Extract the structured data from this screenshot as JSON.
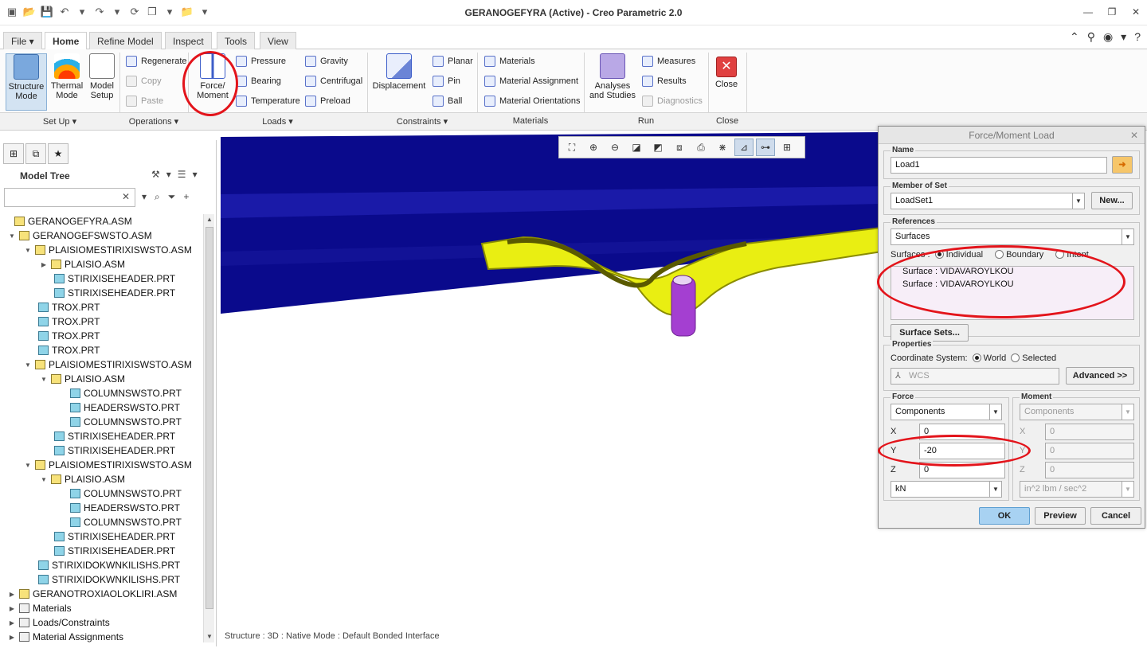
{
  "window": {
    "title": "GERANOGEFYRA (Active) - Creo Parametric 2.0"
  },
  "tabs": [
    {
      "label": "File ▾"
    },
    {
      "label": "Home"
    },
    {
      "label": "Refine Model"
    },
    {
      "label": "Inspect"
    },
    {
      "label": "Tools"
    },
    {
      "label": "View"
    }
  ],
  "ribbon": {
    "setup": {
      "structure": "Structure Mode",
      "thermal": "Thermal Mode",
      "model_setup": "Model Setup",
      "group": "Set Up ▾"
    },
    "operations": {
      "regenerate": "Regenerate",
      "copy": "Copy",
      "paste": "Paste",
      "group": "Operations ▾"
    },
    "loads": {
      "force_moment": "Force/ Moment",
      "pressure": "Pressure",
      "bearing": "Bearing",
      "temperature": "Temperature",
      "gravity": "Gravity",
      "centrifugal": "Centrifugal",
      "preload": "Preload",
      "group": "Loads ▾"
    },
    "constraints": {
      "displacement": "Displacement",
      "planar": "Planar",
      "pin": "Pin",
      "ball": "Ball",
      "group": "Constraints ▾"
    },
    "materials": {
      "materials": "Materials",
      "assignment": "Material Assignment",
      "orientations": "Material Orientations",
      "group": "Materials"
    },
    "run": {
      "analyses": "Analyses and Studies",
      "measures": "Measures",
      "results": "Results",
      "diagnostics": "Diagnostics",
      "group": "Run"
    },
    "close": {
      "label": "Close",
      "group": "Close"
    }
  },
  "model_tree": {
    "title": "Model Tree",
    "items": [
      {
        "label": "GERANOGEFYRA.ASM"
      },
      {
        "label": "GERANOGEFSWSTO.ASM"
      },
      {
        "label": "PLAISIOMESTIRIXISWSTO.ASM"
      },
      {
        "label": "PLAISIO.ASM"
      },
      {
        "label": "STIRIXISEHEADER.PRT"
      },
      {
        "label": "STIRIXISEHEADER.PRT"
      },
      {
        "label": "TROX.PRT"
      },
      {
        "label": "TROX.PRT"
      },
      {
        "label": "TROX.PRT"
      },
      {
        "label": "TROX.PRT"
      },
      {
        "label": "PLAISIOMESTIRIXISWSTO.ASM"
      },
      {
        "label": "PLAISIO.ASM"
      },
      {
        "label": "COLUMNSWSTO.PRT"
      },
      {
        "label": "HEADERSWSTO.PRT"
      },
      {
        "label": "COLUMNSWSTO.PRT"
      },
      {
        "label": "STIRIXISEHEADER.PRT"
      },
      {
        "label": "STIRIXISEHEADER.PRT"
      },
      {
        "label": "PLAISIOMESTIRIXISWSTO.ASM"
      },
      {
        "label": "PLAISIO.ASM"
      },
      {
        "label": "COLUMNSWSTO.PRT"
      },
      {
        "label": "HEADERSWSTO.PRT"
      },
      {
        "label": "COLUMNSWSTO.PRT"
      },
      {
        "label": "STIRIXISEHEADER.PRT"
      },
      {
        "label": "STIRIXISEHEADER.PRT"
      },
      {
        "label": "STIRIXIDOKWNKILISHS.PRT"
      },
      {
        "label": "STIRIXIDOKWNKILISHS.PRT"
      },
      {
        "label": "GERANOTROXIAOLOKLIRI.ASM"
      },
      {
        "label": "Materials"
      },
      {
        "label": "Loads/Constraints"
      },
      {
        "label": "Material Assignments"
      }
    ]
  },
  "status": {
    "text": "Structure : 3D : Native Mode : Default Bonded Interface"
  },
  "dialog": {
    "title": "Force/Moment Load",
    "name_legend": "Name",
    "name_value": "Load1",
    "member_legend": "Member of Set",
    "member_value": "LoadSet1",
    "new_btn": "New...",
    "references_legend": "References",
    "references_type": "Surfaces",
    "surfaces_label": "Surfaces :",
    "opt_individual": "Individual",
    "opt_boundary": "Boundary",
    "opt_intent": "Intent",
    "ref_items": [
      {
        "label": "Surface : VIDAVAROYLKOU"
      },
      {
        "label": "Surface : VIDAVAROYLKOU"
      }
    ],
    "surface_sets_btn": "Surface Sets...",
    "properties_legend": "Properties",
    "coord_label": "Coordinate System:",
    "coord_world": "World",
    "coord_selected": "Selected",
    "wcs_value": "WCS",
    "advanced_btn": "Advanced >>",
    "force_legend": "Force",
    "force_type": "Components",
    "force_x": "0",
    "force_y": "-20",
    "force_z": "0",
    "force_units": "kN",
    "moment_legend": "Moment",
    "moment_type": "Components",
    "moment_x": "0",
    "moment_y": "0",
    "moment_z": "0",
    "moment_units": "in^2 lbm / sec^2",
    "label_x": "X",
    "label_y": "Y",
    "label_z": "Z",
    "ok_btn": "OK",
    "preview_btn": "Preview",
    "cancel_btn": "Cancel"
  },
  "colors": {
    "annotation": "#e3141b",
    "beam_dark": "#0a0a8c",
    "beam_mid": "#1515a8",
    "part_yellow": "#e9ee12",
    "load_purple": "#a43fd1"
  }
}
